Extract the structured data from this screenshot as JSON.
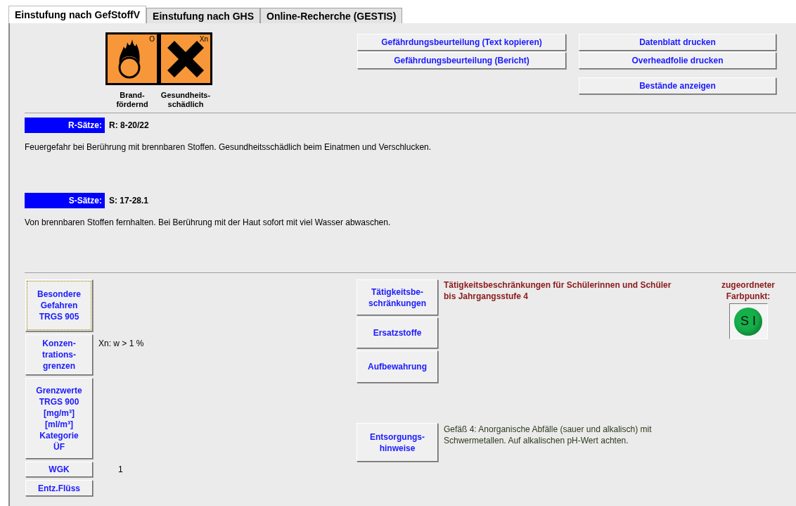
{
  "tabs": [
    {
      "label": "Einstufung nach GefStoffV",
      "selected": true
    },
    {
      "label": "Einstufung nach GHS",
      "selected": false
    },
    {
      "label": "Online-Recherche (GESTIS)",
      "selected": false
    }
  ],
  "hazard_symbols": [
    {
      "kind": "flame-over-circle",
      "code": "O",
      "label": "Brand-\nfördernd"
    },
    {
      "kind": "cross",
      "code": "Xn",
      "label": "Gesundheits-\nschädlich"
    }
  ],
  "report_buttons": [
    {
      "label": "Gefährdungsbeurteilung (Text kopieren)"
    },
    {
      "label": "Gefährdungsbeurteilung (Bericht)"
    }
  ],
  "print_buttons": [
    {
      "label": "Datenblatt drucken"
    },
    {
      "label": "Overheadfolie drucken"
    },
    {
      "label": "Bestände anzeigen"
    }
  ],
  "phrases": [
    {
      "label": "R-Sätze:",
      "codes": "R: 8-20/22",
      "text": "Feuergefahr bei Berührung mit brennbaren Stoffen. Gesundheitsschädlich beim Einatmen und Verschlucken."
    },
    {
      "label": "S-Sätze:",
      "codes": "S: 17-28.1",
      "text": "Von brennbaren Stoffen fernhalten. Bei Berührung mit der Haut sofort mit viel Wasser abwaschen."
    }
  ],
  "property_buttons": [
    {
      "label": "Besondere\nGefahren\nTRGS 905",
      "focused": true
    },
    {
      "label": "Konzen-\ntrations-\ngrenzen",
      "focused": false,
      "value": "Xn: w > 1 %"
    },
    {
      "label": "Grenzwerte\nTRGS 900\n[mg/m³]\n[ml/m³]\nKategorie\nÜF",
      "focused": false
    },
    {
      "label": "WGK",
      "focused": false,
      "value": "1"
    },
    {
      "label": "Entz.Flüss",
      "focused": false
    }
  ],
  "info_buttons": [
    {
      "label": "Tätigkeitsbe-\nschränkungen",
      "note": {
        "kind": "warning",
        "text": "Tätigkeitsbeschränkungen für Schülerinnen und Schüler\nbis Jahrgangsstufe 4"
      }
    },
    {
      "label": "Ersatzstoffe"
    },
    {
      "label": "Aufbewahrung"
    },
    {
      "label": "Entsorgungs-\nhinweise",
      "note": {
        "kind": "info",
        "text": "Gefäß 4: Anorganische Abfälle (sauer und alkalisch) mit\nSchwermetallen. Auf alkalischen pH-Wert achten."
      }
    }
  ],
  "color_point": {
    "label": "zugeordneter\nFarbpunkt:",
    "code": "S I",
    "color": "#16b04a"
  }
}
